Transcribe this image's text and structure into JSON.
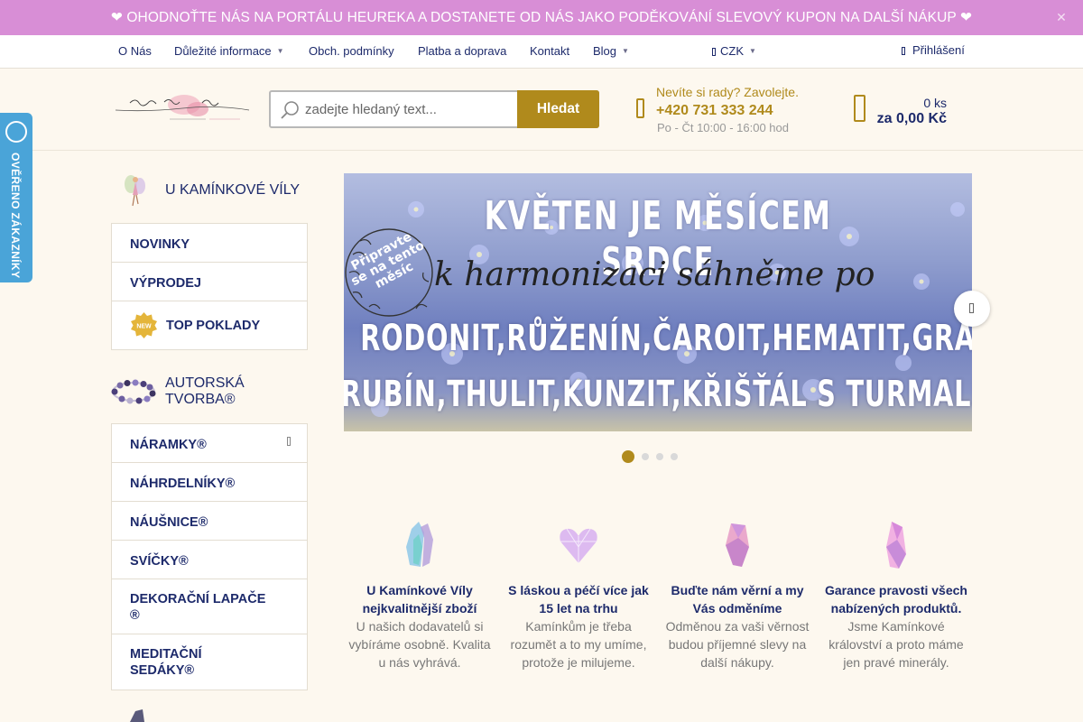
{
  "banner": {
    "text": "❤ OHODNOŤTE NÁS NA PORTÁLU HEUREKA A DOSTANETE OD NÁS JAKO PODĚKOVÁNÍ SLEVOVÝ KUPON NA DALŠÍ NÁKUP ❤",
    "close": "✕"
  },
  "nav": {
    "items": [
      {
        "label": "O Nás"
      },
      {
        "label": "Důležité informace"
      },
      {
        "label": "Obch. podmínky"
      },
      {
        "label": "Platba a doprava"
      },
      {
        "label": "Kontakt"
      },
      {
        "label": "Blog"
      }
    ],
    "currency": "CZK",
    "login": "Přihlášení"
  },
  "search": {
    "placeholder": "zadejte hledaný text...",
    "button": "Hledat"
  },
  "help": {
    "question": "Nevíte si rady? Zavolejte.",
    "phone": "+420 731 333 244",
    "hours": "Po - Čt 10:00 - 16:00 hod"
  },
  "cart": {
    "qty": "0 ks",
    "total": "za 0,00 Kč"
  },
  "verified": {
    "text": "OVĚŘENO ZÁKAZNÍKY"
  },
  "sidebar": {
    "section1": {
      "title": "U KAMÍNKOVÉ VÍLY"
    },
    "menu1": [
      {
        "label": "NOVINKY"
      },
      {
        "label": "VÝPRODEJ"
      },
      {
        "label": "TOP POKLADY"
      }
    ],
    "section2": {
      "title": "AUTORSKÁ TVORBA®"
    },
    "menu2": [
      {
        "label": "NÁRAMKY®"
      },
      {
        "label": "NÁHRDELNÍKY®"
      },
      {
        "label": "NÁUŠNICE®"
      },
      {
        "label": "SVÍČKY®"
      },
      {
        "label": "DEKORAČNÍ LAPAČE ®"
      },
      {
        "label": "MEDITAČNÍ SEDÁKY®"
      }
    ]
  },
  "slider": {
    "title": "KVĚTEN JE MĚSÍCEM SRDCE",
    "script": "k harmonizaci sáhněme po",
    "stamp": "Připravte se na tento měsíc",
    "line1": "RODONIT,RŮŽENÍN,ČAROIT,HEMATIT,GRANÁT,",
    "line2": "RUBÍN,THULIT,KUNZIT,KŘIŠŤÁL S TURMALÍNEM",
    "slides": 4,
    "active": 1
  },
  "features": [
    {
      "title": "U Kamínkové Víly nejkvalitnější zboží",
      "text": "U našich dodavatelů si vybíráme osobně. Kvalita u nás vyhrává.",
      "icon": "crystal-icon"
    },
    {
      "title": "S láskou a péčí více jak 15 let na trhu",
      "text": "Kamínkům je třeba rozumět a to my umíme, protože je milujeme.",
      "icon": "heart-crystal-icon"
    },
    {
      "title": "Buďte nám věrní a my Vás odměníme",
      "text": "Odměnou za vaši věrnost budou příjemné slevy na další nákupy.",
      "icon": "gem-icon"
    },
    {
      "title": "Garance pravosti všech nabízených produktů.",
      "text": "Jsme Kamínkové království a proto máme jen pravé minerály.",
      "icon": "amethyst-icon"
    }
  ],
  "colors": {
    "banner": "#d88ed6",
    "accent": "#b08a1c",
    "navy": "#1d2a6b",
    "badge": "#4aa4d8"
  }
}
